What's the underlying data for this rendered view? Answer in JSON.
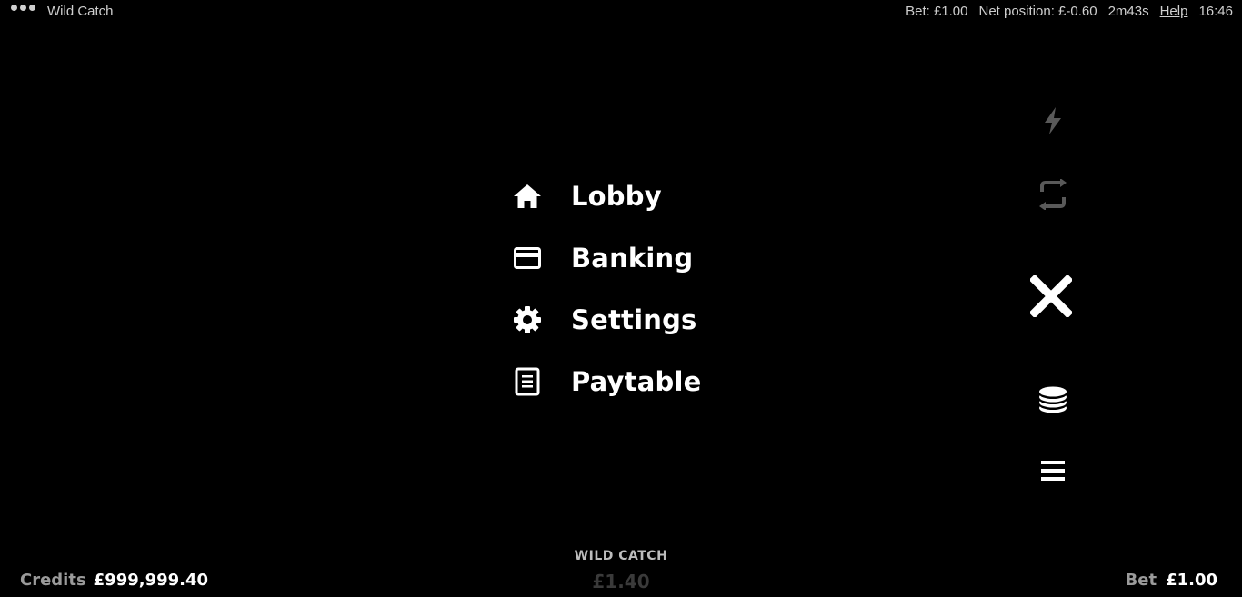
{
  "topbar": {
    "menu_icon": "more-dots-icon",
    "title": "Wild Catch",
    "bet": "Bet: £1.00",
    "net_position": "Net position: £-0.60",
    "session_time": "2m43s",
    "help": "Help",
    "clock": "16:46"
  },
  "menu": {
    "items": [
      {
        "label": "Lobby",
        "icon": "home-icon"
      },
      {
        "label": "Banking",
        "icon": "card-icon"
      },
      {
        "label": "Settings",
        "icon": "gear-icon"
      },
      {
        "label": "Paytable",
        "icon": "document-icon"
      }
    ]
  },
  "side_controls": {
    "turbo_icon": "lightning-icon",
    "autoplay_icon": "autoplay-icon",
    "close_icon": "close-icon",
    "bet_icon": "coins-icon",
    "menu_icon": "hamburger-icon"
  },
  "bottom": {
    "credits_label": "Credits",
    "credits_value": "£999,999.40",
    "game_name": "WILD CATCH",
    "win_amount": "£1.40",
    "bet_label": "Bet",
    "bet_value": "£1.00"
  },
  "colors": {
    "background": "#000000",
    "text": "#ffffff",
    "muted": "#9a9a9a"
  }
}
